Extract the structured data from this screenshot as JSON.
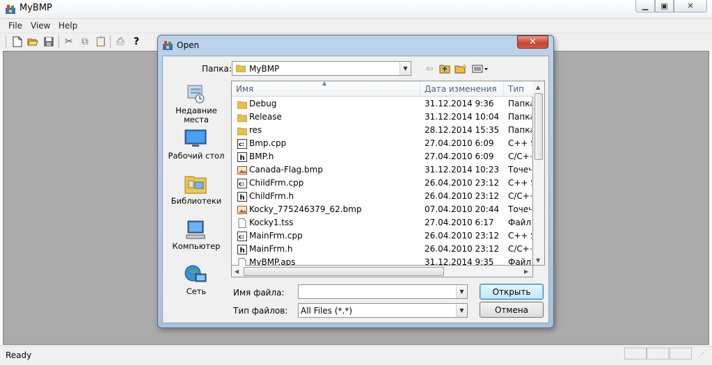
{
  "app": {
    "title": "MyBMP",
    "menu": [
      "File",
      "View",
      "Help"
    ],
    "status": "Ready"
  },
  "dialog": {
    "title": "Open",
    "close_glyph": "✕",
    "look_in_label": "Папка:",
    "look_in_value": "MyBMP",
    "places": [
      {
        "label": "Недавние места",
        "icon": "recent-places-icon"
      },
      {
        "label": "Рабочий стол",
        "icon": "desktop-icon"
      },
      {
        "label": "Библиотеки",
        "icon": "libraries-icon"
      },
      {
        "label": "Компьютер",
        "icon": "computer-icon"
      },
      {
        "label": "Сеть",
        "icon": "network-icon"
      }
    ],
    "columns": {
      "name": "Имя",
      "date": "Дата изменения",
      "type": "Тип"
    },
    "files": [
      {
        "name": "Debug",
        "date": "31.12.2014 9:36",
        "type": "Папка",
        "icon": "folder"
      },
      {
        "name": "Release",
        "date": "31.12.2014 10:04",
        "type": "Папка",
        "icon": "folder"
      },
      {
        "name": "res",
        "date": "28.12.2014 15:35",
        "type": "Папка",
        "icon": "folder"
      },
      {
        "name": "Bmp.cpp",
        "date": "27.04.2010 6:09",
        "type": "C++ So",
        "icon": "cpp"
      },
      {
        "name": "BMP.h",
        "date": "27.04.2010 6:09",
        "type": "C/C++",
        "icon": "h"
      },
      {
        "name": "Canada-Flag.bmp",
        "date": "31.12.2014 10:23",
        "type": "Точеч",
        "icon": "bmp"
      },
      {
        "name": "ChildFrm.cpp",
        "date": "26.04.2010 23:12",
        "type": "C++ So",
        "icon": "cpp"
      },
      {
        "name": "ChildFrm.h",
        "date": "26.04.2010 23:12",
        "type": "C/C++",
        "icon": "h"
      },
      {
        "name": "Kocky_775246379_62.bmp",
        "date": "07.04.2010 20:44",
        "type": "Точеч",
        "icon": "bmp"
      },
      {
        "name": "Kocky1.tss",
        "date": "27.04.2010 6:17",
        "type": "Файл",
        "icon": "file"
      },
      {
        "name": "MainFrm.cpp",
        "date": "26.04.2010 23:12",
        "type": "C++ So",
        "icon": "cpp"
      },
      {
        "name": "MainFrm.h",
        "date": "26.04.2010 23:12",
        "type": "C/C++",
        "icon": "h"
      },
      {
        "name": "MyBMP.aps",
        "date": "31.12.2014 9:35",
        "type": "Файл",
        "icon": "file"
      }
    ],
    "filename_label": "Имя файла:",
    "filename_value": "",
    "filetype_label": "Тип файлов:",
    "filetype_value": "All Files (*.*)",
    "open_label": "Открыть",
    "cancel_label": "Отмена"
  }
}
